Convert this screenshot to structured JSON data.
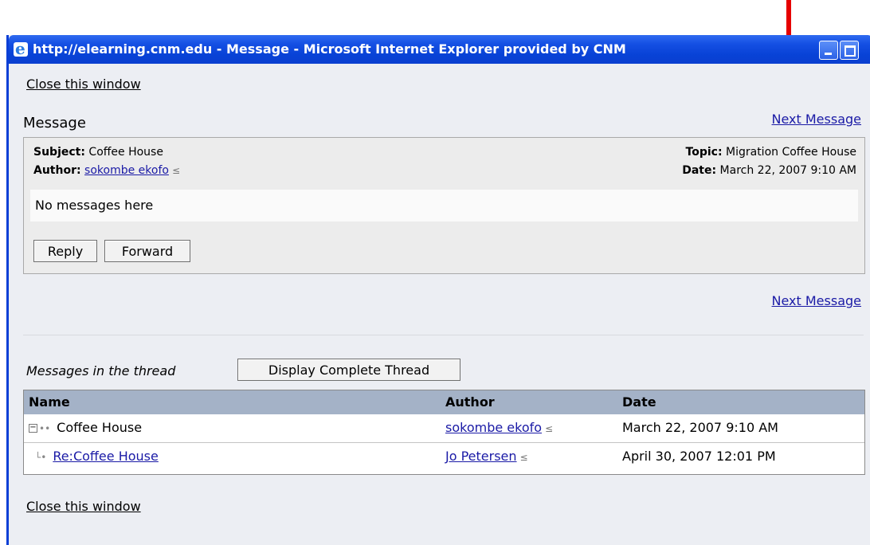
{
  "annotation": {
    "arrow_color": "#e60000"
  },
  "window": {
    "title": "http://elearning.cnm.edu - Message - Microsoft Internet Explorer provided by CNM",
    "icon": "ie-icon"
  },
  "links": {
    "close_top": "Close this window",
    "close_bottom": "Close this window",
    "next_top": "Next Message",
    "next_bottom": "Next Message"
  },
  "message": {
    "heading": "Message",
    "subject_label": "Subject:",
    "subject": "Coffee House",
    "author_label": "Author:",
    "author": "sokombe ekofo",
    "topic_label": "Topic:",
    "topic": "Migration Coffee House",
    "date_label": "Date:",
    "date": "March 22, 2007 9:10 AM",
    "body": "No messages here",
    "reply_label": "Reply",
    "forward_label": "Forward"
  },
  "thread": {
    "label": "Messages in the thread",
    "display_button": "Display Complete Thread",
    "columns": [
      "Name",
      "Author",
      "Date"
    ],
    "rows": [
      {
        "name": "Coffee House",
        "author": "sokombe ekofo",
        "date": "March 22, 2007 9:10 AM"
      },
      {
        "name": "Re:Coffee House",
        "author": "Jo Petersen",
        "date": "April 30, 2007 12:01 PM"
      }
    ]
  }
}
